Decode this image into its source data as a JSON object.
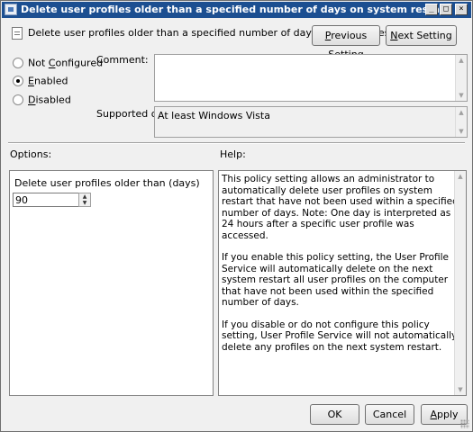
{
  "window": {
    "title": "Delete user profiles older than a specified number of days on system restart",
    "minimize_glyph": "_",
    "maximize_glyph": "□",
    "close_glyph": "×"
  },
  "header": {
    "policy_title": "Delete user profiles older than a specified number of days on system restart",
    "prev_button": {
      "prefix": "",
      "accel": "P",
      "rest": "revious Setting"
    },
    "next_button": {
      "prefix": "",
      "accel": "N",
      "rest": "ext Setting"
    }
  },
  "state": {
    "not_configured": {
      "pre": "Not ",
      "accel": "C",
      "post": "onfigured",
      "selected": false
    },
    "enabled": {
      "pre": "",
      "accel": "E",
      "post": "nabled",
      "selected": true
    },
    "disabled": {
      "pre": "",
      "accel": "D",
      "post": "isabled",
      "selected": false
    }
  },
  "comment": {
    "label": "Comment:",
    "value": ""
  },
  "supported": {
    "label": "Supported on:",
    "value": "At least Windows Vista"
  },
  "options": {
    "label": "Options:",
    "field_label": "Delete user profiles older than (days)",
    "field_value": "90"
  },
  "help": {
    "label": "Help:",
    "paragraphs": [
      "This policy setting allows an administrator to automatically delete user profiles on system restart that have not been used within a specified number of days. Note: One day is interpreted as 24 hours after a specific user profile was accessed.",
      "If you enable this policy setting, the User Profile Service will automatically delete on the next system restart all user profiles on the computer that have not been used within the specified number of days.",
      "If you disable or do not configure this policy setting, User Profile Service will not automatically delete any profiles on the next system restart."
    ]
  },
  "footer": {
    "ok": "OK",
    "cancel": "Cancel",
    "apply": {
      "accel": "A",
      "rest": "pply"
    }
  },
  "colors": {
    "titlebar": "#1c4f91",
    "dialog_bg": "#f0f0f0"
  }
}
